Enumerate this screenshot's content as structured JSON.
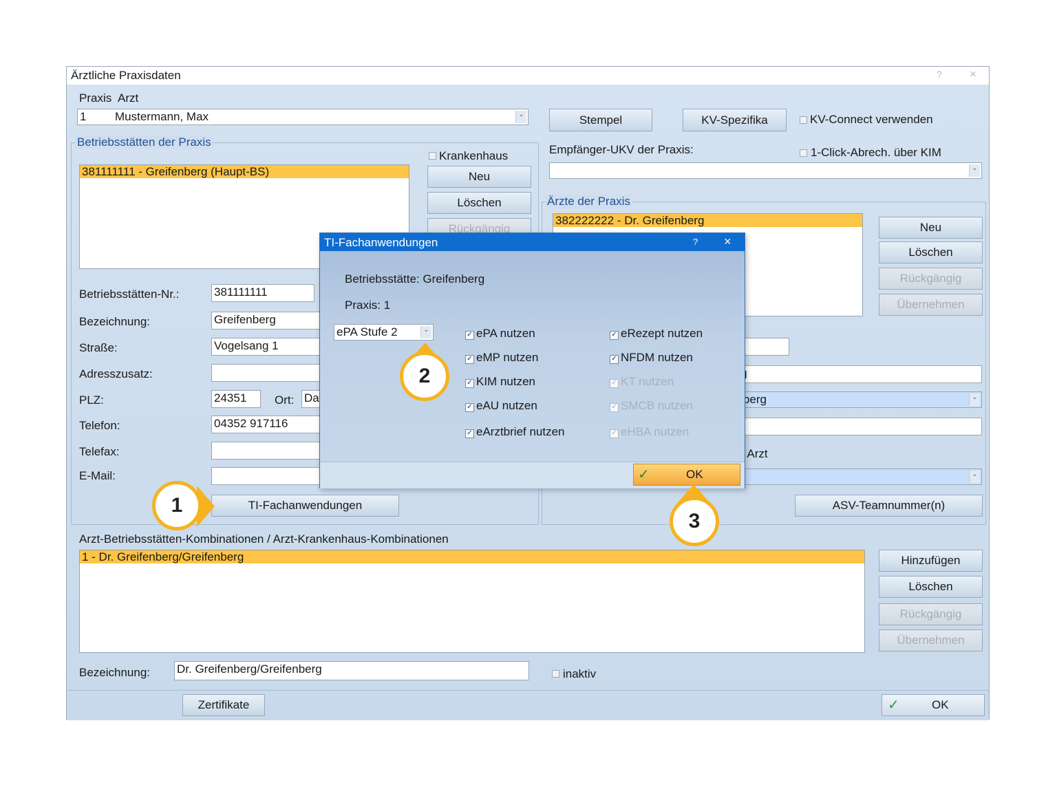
{
  "window": {
    "title": "Ärztliche Praxisdaten",
    "help": "?",
    "close": "×"
  },
  "praxis": {
    "label_praxis": "Praxis",
    "label_arzt": "Arzt",
    "nr": "1",
    "name": "Mustermann, Max"
  },
  "top_buttons": {
    "stempel": "Stempel",
    "kv_spezifika": "KV-Spezifika",
    "kv_connect": "KV-Connect verwenden"
  },
  "bs_group": {
    "title": "Betriebsstätten der Praxis",
    "krankenhaus": "Krankenhaus",
    "selected": "381111111 - Greifenberg (Haupt-BS)",
    "neu": "Neu",
    "loeschen": "Löschen",
    "rueckgaengig": "Rückgängig"
  },
  "empf": {
    "label": "Empfänger-UKV der Praxis:",
    "one_click": "1-Click-Abrech. über KIM"
  },
  "aerzte": {
    "title": "Ärzte der Praxis",
    "selected": "382222222 - Dr. Greifenberg",
    "neu": "Neu",
    "loeschen": "Löschen",
    "rueckgaengig": "Rückgängig",
    "uebernehmen": "Übernehmen",
    "f1": "erg",
    "f2": "enberg",
    "lbl": "her Arzt",
    "asv": "ASV-Teamnummer(n)"
  },
  "form": {
    "bsnr_label": "Betriebsstätten-Nr.:",
    "bsnr": "381111111",
    "bez_label": "Bezeichnung:",
    "bez": "Greifenberg",
    "str_label": "Straße:",
    "str": "Vogelsang 1",
    "adr_label": "Adresszusatz:",
    "plz_label": "PLZ:",
    "plz": "24351",
    "ort_label": "Ort:",
    "ort": "Dar",
    "tel_label": "Telefon:",
    "tel": "04352 917116",
    "fax_label": "Telefax:",
    "mail_label": "E-Mail:",
    "ti_button": "TI-Fachanwendungen"
  },
  "kombi": {
    "title": "Arzt-Betriebsstätten-Kombinationen / Arzt-Krankenhaus-Kombinationen",
    "selected": "1 - Dr. Greifenberg/Greifenberg",
    "hinzufuegen": "Hinzufügen",
    "loeschen": "Löschen",
    "rueckgaengig": "Rückgängig",
    "uebernehmen": "Übernehmen",
    "bez_label": "Bezeichnung:",
    "bez": "Dr. Greifenberg/Greifenberg",
    "inaktiv": "inaktiv"
  },
  "footer": {
    "zertifikate": "Zertifikate",
    "ok": "OK"
  },
  "dialog": {
    "title": "TI-Fachanwendungen",
    "help": "?",
    "close": "×",
    "bs": "Betriebsstätte: Greifenberg",
    "praxis": "Praxis: 1",
    "combo": "ePA Stufe 2",
    "left": [
      "ePA nutzen",
      "eMP nutzen",
      "KIM nutzen",
      "eAU nutzen",
      "eArztbrief nutzen"
    ],
    "right": [
      "eRezept nutzen",
      "NFDM nutzen",
      "KT nutzen",
      "SMCB nutzen",
      "eHBA nutzen"
    ],
    "ok": "OK"
  },
  "badges": [
    "1",
    "2",
    "3"
  ],
  "colors": {
    "selection": "#fdc447",
    "dialog_title": "#0f6dcf",
    "badge_ring": "#f6b320"
  }
}
